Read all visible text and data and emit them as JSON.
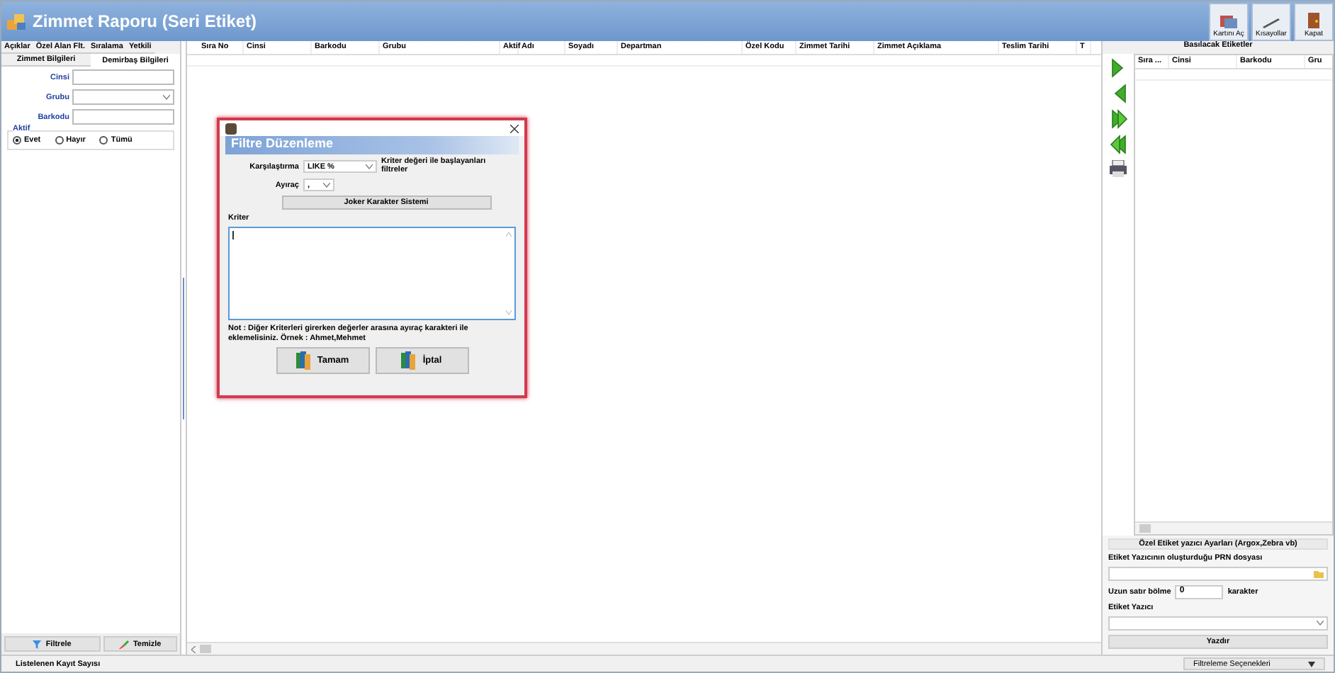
{
  "window": {
    "title": "Zimmet Raporu (Seri Etiket)"
  },
  "toolbar": [
    {
      "label": "Kartını Aç",
      "kind": "card"
    },
    {
      "label": "Kısayollar",
      "kind": "shortcut"
    },
    {
      "label": "Kapat",
      "kind": "close"
    }
  ],
  "left_panel": {
    "tabs": [
      {
        "label": "Açıklar",
        "selected": false
      },
      {
        "label": "Özel Alan Flt.",
        "selected": false
      },
      {
        "label": "Sıralama",
        "selected": false
      },
      {
        "label": "Yetkili",
        "selected": false
      }
    ],
    "subtabs": [
      {
        "label": "Zimmet Bilgileri",
        "selected": false
      },
      {
        "label": "Demirbaş Bilgileri",
        "selected": true
      }
    ],
    "fields": [
      {
        "label": "Cinsi",
        "kind": "text"
      },
      {
        "label": "Grubu",
        "kind": "select"
      },
      {
        "label": "Barkodu",
        "kind": "text"
      }
    ],
    "aktif": {
      "label": "Aktif",
      "options": [
        {
          "label": "Evet",
          "selected": true
        },
        {
          "label": "Hayır",
          "selected": false
        },
        {
          "label": "Tümü",
          "selected": false
        }
      ]
    },
    "filter_button": "Filtrele",
    "clear_button": "Temizle"
  },
  "main_grid": {
    "columns": [
      "Sıra No",
      "Cinsi",
      "Barkodu",
      "Grubu",
      "Aktif",
      "Adı",
      "Soyadı",
      "Departman",
      "Özel Kodu",
      "Zimmet Tarihi",
      "Zimmet Açıklama",
      "Teslim Tarihi",
      "T"
    ]
  },
  "right_panel": {
    "title": "Basılacak Etiketler",
    "columns": [
      "Sıra ...",
      "Cinsi",
      "Barkodu",
      "Gru"
    ],
    "settings_title": "Özel Etiket yazıcı Ayarları (Argox,Zebra vb)",
    "prn_label": "Etiket Yazıcının oluşturduğu PRN dosyası",
    "split_label": "Uzun satır bölme",
    "split_value": "0",
    "split_unit": "karakter",
    "printer_label": "Etiket Yazıcı",
    "print_button": "Yazdır"
  },
  "status_bar": {
    "label": "Listelenen Kayıt Sayısı",
    "filter_options": "Filtreleme Seçenekleri"
  },
  "dialog": {
    "title": "Filtre Düzenleme",
    "compare_label": "Karşılaştırma",
    "compare_value": "LIKE %",
    "compare_hint": "Kriter değeri ile başlayanları filtreler",
    "separator_label": "Ayıraç",
    "separator_value": ",",
    "joker_button": "Joker Karakter Sistemi",
    "criteria_label": "Kriter",
    "note": "Not : Diğer Kriterleri girerken değerler arasına ayıraç karakteri ile eklemelisiniz. Örnek : Ahmet,Mehmet",
    "ok_button": "Tamam",
    "cancel_button": "İptal"
  }
}
